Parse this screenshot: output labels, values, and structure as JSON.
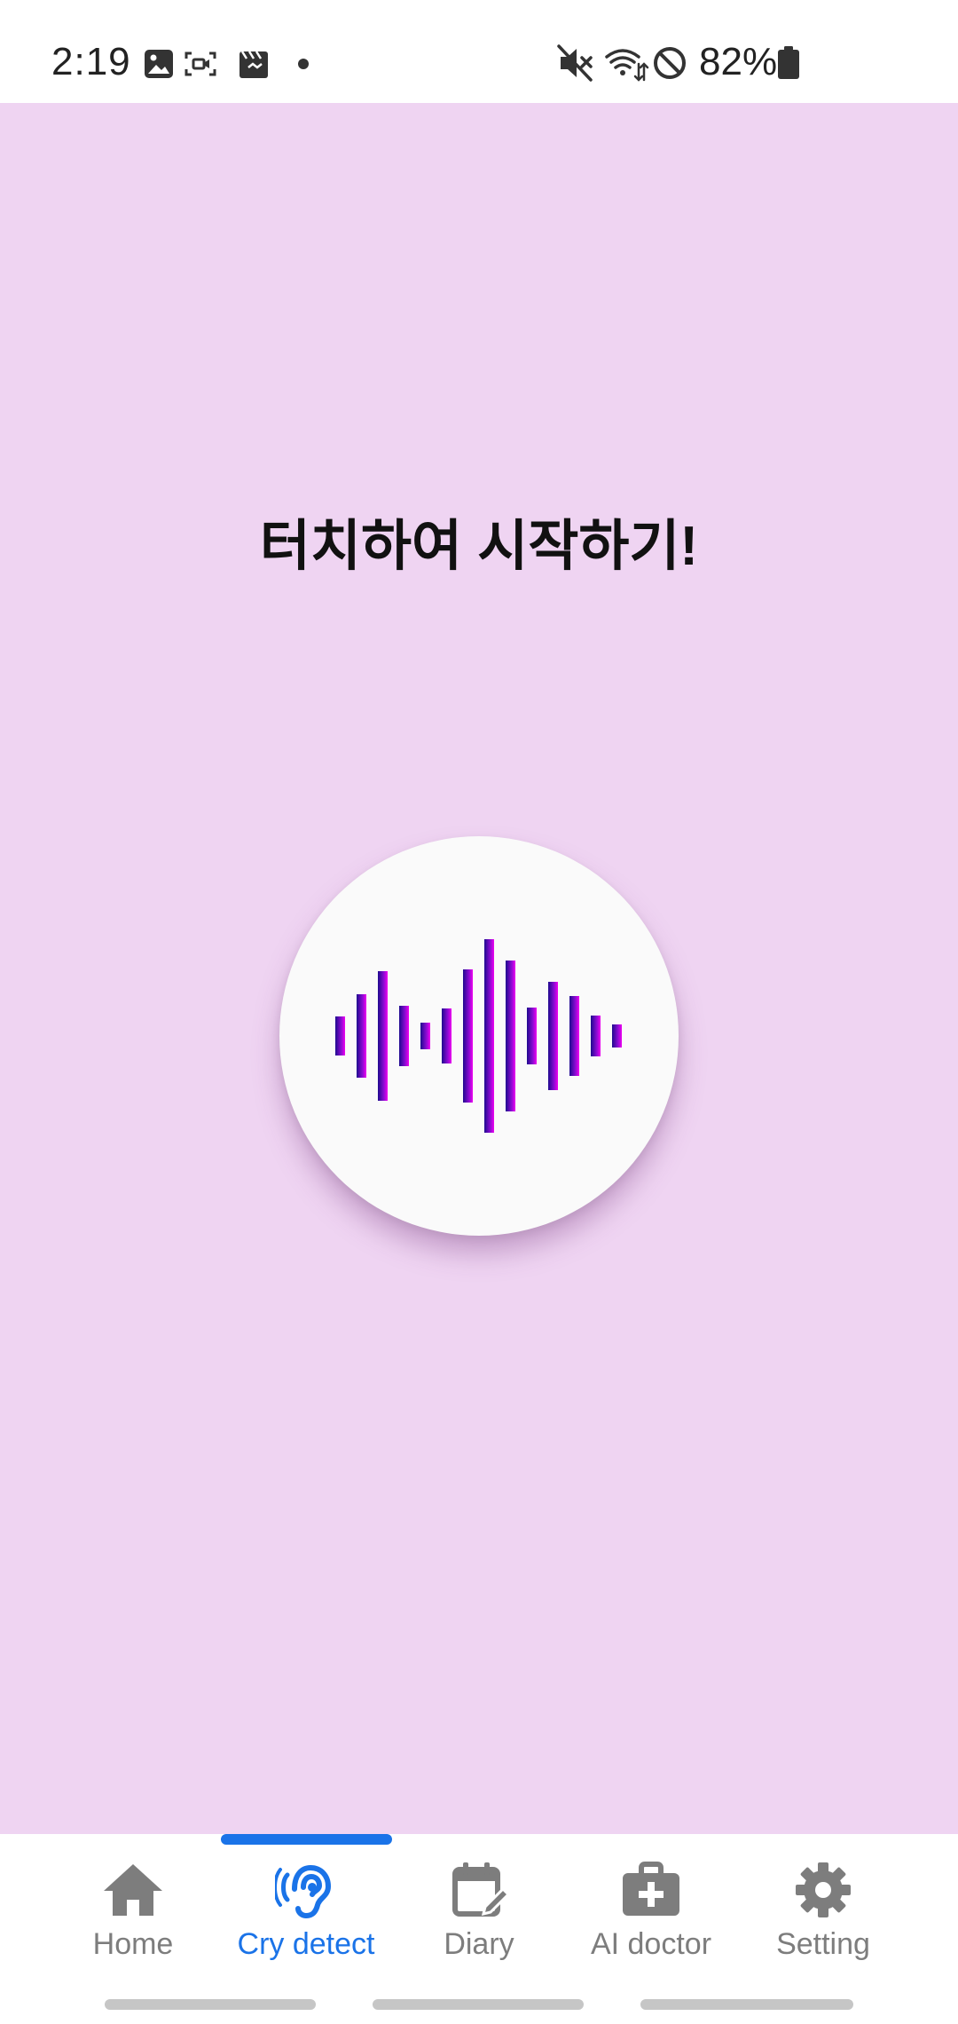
{
  "status_bar": {
    "time": "2:19",
    "left_icons": [
      "gallery-icon",
      "screen-record-icon",
      "video-clip-icon",
      "dot-icon"
    ],
    "right_icons": [
      "mute-icon",
      "wifi-icon",
      "do-not-disturb-icon"
    ],
    "battery": "82%"
  },
  "main": {
    "prompt": "터치하여 시작하기!",
    "background_color": "#efd4f2",
    "record_button": {
      "icon": "sound-wave-icon",
      "wave_colors": [
        "#1e0a8f",
        "#8a0bd2",
        "#f000f0"
      ]
    }
  },
  "bottom_nav": {
    "active_color": "#1a73e8",
    "inactive_color": "#7d7d7d",
    "items": [
      {
        "label": "Home",
        "icon": "home-icon",
        "active": false
      },
      {
        "label": "Cry detect",
        "icon": "ear-icon",
        "active": true
      },
      {
        "label": "Diary",
        "icon": "calendar-edit-icon",
        "active": false
      },
      {
        "label": "AI doctor",
        "icon": "medical-kit-icon",
        "active": false
      },
      {
        "label": "Setting",
        "icon": "gear-icon",
        "active": false
      }
    ]
  }
}
